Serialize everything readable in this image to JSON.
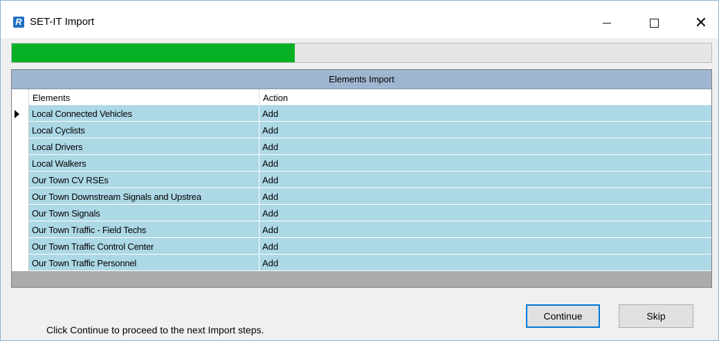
{
  "window": {
    "title": "SET-IT Import",
    "icon_letter": "R",
    "controls": {
      "minimize": "minimize",
      "maximize": "maximize",
      "close": "✕"
    }
  },
  "progress": {
    "value_fraction": 0.405,
    "color": "#06b025"
  },
  "grid": {
    "caption": "Elements Import",
    "columns": [
      "Elements",
      "Action"
    ],
    "selected_row": 0,
    "row_color": "#add8e6",
    "rows": [
      {
        "element": "Local Connected Vehicles",
        "action": "Add"
      },
      {
        "element": "Local Cyclists",
        "action": "Add"
      },
      {
        "element": "Local Drivers",
        "action": "Add"
      },
      {
        "element": "Local Walkers",
        "action": "Add"
      },
      {
        "element": "Our Town CV RSEs",
        "action": "Add"
      },
      {
        "element": "Our Town Downstream Signals and Upstrea",
        "action": "Add"
      },
      {
        "element": "Our Town Signals",
        "action": "Add"
      },
      {
        "element": "Our Town Traffic - Field Techs",
        "action": "Add"
      },
      {
        "element": "Our Town Traffic Control Center",
        "action": "Add"
      },
      {
        "element": "Our Town Traffic Personnel",
        "action": "Add"
      }
    ]
  },
  "footer": {
    "hint": "Click Continue to proceed to the next Import steps.",
    "continue_label": "Continue",
    "skip_label": "Skip"
  }
}
